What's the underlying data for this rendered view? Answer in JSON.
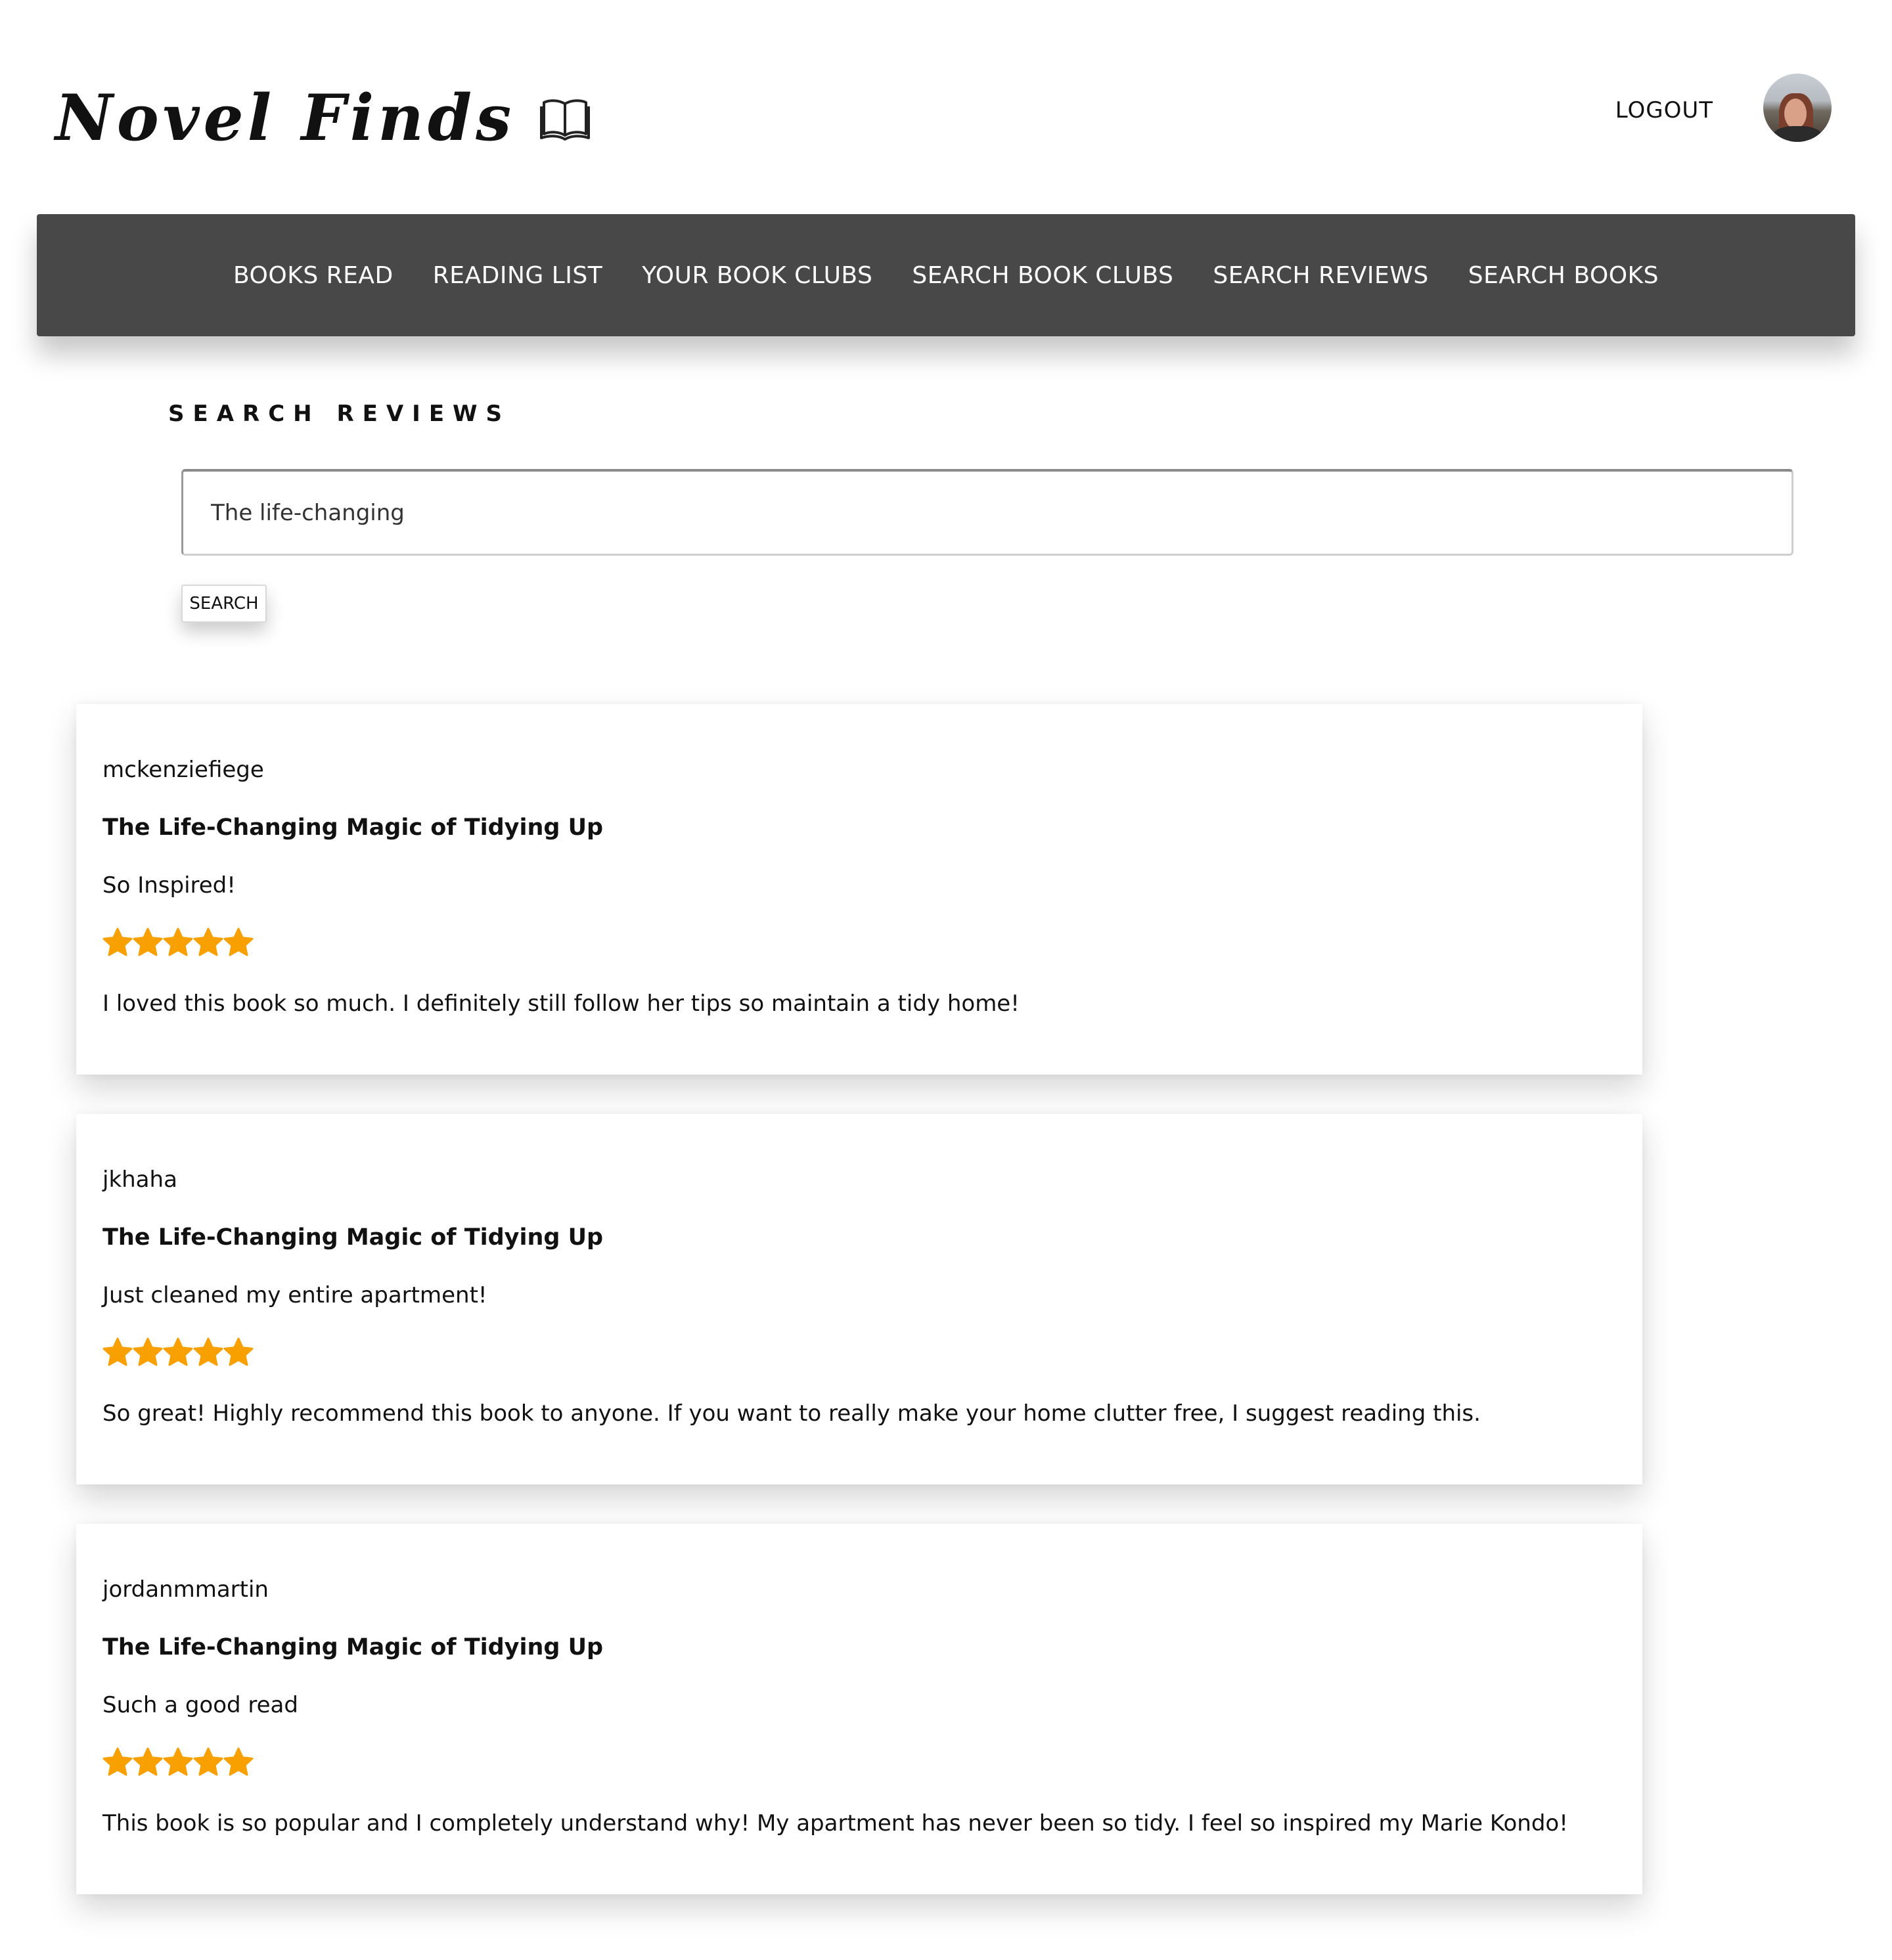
{
  "app": {
    "logo_text": "Novel Finds",
    "logout_label": "LOGOUT"
  },
  "nav": {
    "items": [
      {
        "label": "BOOKS READ"
      },
      {
        "label": "READING LIST"
      },
      {
        "label": "YOUR BOOK CLUBS"
      },
      {
        "label": "SEARCH BOOK CLUBS"
      },
      {
        "label": "SEARCH REVIEWS"
      },
      {
        "label": "SEARCH BOOKS"
      }
    ]
  },
  "search": {
    "heading": "SEARCH REVIEWS",
    "query": "The life-changing",
    "button_label": "SEARCH"
  },
  "reviews": [
    {
      "username": "mckenziefiege",
      "book_title": "The Life-Changing Magic of Tidying Up",
      "review_title": "So Inspired!",
      "rating": 5,
      "rating_max": 5,
      "body": "I loved this book so much. I definitely still follow her tips so maintain a tidy home!"
    },
    {
      "username": "jkhaha",
      "book_title": "The Life-Changing Magic of Tidying Up",
      "review_title": "Just cleaned my entire apartment!",
      "rating": 5,
      "rating_max": 5,
      "body": "So great! Highly recommend this book to anyone. If you want to really make your home clutter free, I suggest reading this."
    },
    {
      "username": "jordanmmartin",
      "book_title": "The Life-Changing Magic of Tidying Up",
      "review_title": "Such a good read",
      "rating": 5,
      "rating_max": 5,
      "body": "This book is so popular and I completely understand why! My apartment has never been so tidy. I feel so inspired my Marie Kondo!"
    }
  ],
  "colors": {
    "nav_background": "#484848",
    "star": "#F7A000",
    "text": "#111111"
  },
  "icons": {
    "logo": "open-book-icon",
    "rating": "star-icon"
  }
}
